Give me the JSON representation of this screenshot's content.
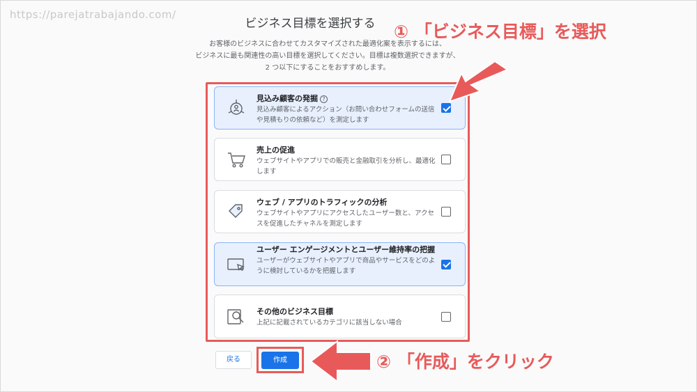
{
  "watermark": "https://parejatrabajando.com/",
  "page_title": "ビジネス目標を選択する",
  "intro_lines": [
    "お客様のビジネスに合わせてカスタマイズされた最適化案を表示するには、",
    "ビジネスに最も関連性の高い目標を選択してください。目標は複数選択できますが、",
    "2 つ以下にすることをおすすめします。"
  ],
  "goals": [
    {
      "title": "見込み顧客の発掘",
      "help": "?",
      "desc": "見込み顧客によるアクション（お問い合わせフォームの送信や見積もりの依頼など）を測定します",
      "checked": true,
      "icon": "lead-target-icon"
    },
    {
      "title": "売上の促進",
      "desc": "ウェブサイトやアプリでの販売と金融取引を分析し、最適化します",
      "checked": false,
      "icon": "shopping-cart-icon"
    },
    {
      "title": "ウェブ / アプリのトラフィックの分析",
      "desc": "ウェブサイトやアプリにアクセスしたユーザー数と、アクセスを促進したチャネルを測定します",
      "checked": false,
      "icon": "tag-icon"
    },
    {
      "title": "ユーザー エンゲージメントとユーザー維持率の把握",
      "desc": "ユーザーがウェブサイトやアプリで商品やサービスをどのように検討しているかを把握します",
      "checked": true,
      "icon": "screen-cursor-icon"
    },
    {
      "title": "その他のビジネス目標",
      "desc": "上記に記載されているカテゴリに該当しない場合",
      "checked": false,
      "icon": "magnifier-icon"
    }
  ],
  "buttons": {
    "back": "戻る",
    "create": "作成"
  },
  "annotations": {
    "step1": "① 「ビジネス目標」を選択",
    "step2": "② 「作成」をクリック"
  },
  "colors": {
    "annotation": "#e85a5a",
    "primary": "#1a73e8",
    "selected_bg": "#e8f0fe"
  }
}
